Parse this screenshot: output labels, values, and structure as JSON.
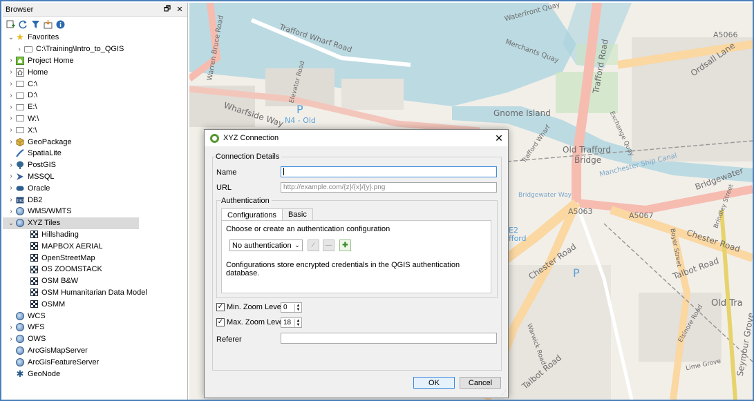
{
  "browser": {
    "title": "Browser",
    "title_buttons": [
      "🗗",
      "✕"
    ],
    "toolbar_icons": [
      "add-layer-icon",
      "refresh-icon",
      "filter-icon",
      "collapse-all-icon",
      "info-icon"
    ],
    "items": [
      {
        "label": "Favorites",
        "icon": "star-icon",
        "expanded": true
      },
      {
        "label": "C:\\Training\\Intro_to_QGIS",
        "icon": "folder-icon"
      },
      {
        "label": "Project Home",
        "icon": "project-home-icon"
      },
      {
        "label": "Home",
        "icon": "home-icon"
      },
      {
        "label": "C:\\",
        "icon": "drive-icon"
      },
      {
        "label": "D:\\",
        "icon": "drive-icon"
      },
      {
        "label": "E:\\",
        "icon": "drive-icon"
      },
      {
        "label": "W:\\",
        "icon": "drive-icon"
      },
      {
        "label": "X:\\",
        "icon": "drive-icon"
      },
      {
        "label": "GeoPackage",
        "icon": "geopackage-icon"
      },
      {
        "label": "SpatiaLite",
        "icon": "spatialite-icon"
      },
      {
        "label": "PostGIS",
        "icon": "postgis-icon"
      },
      {
        "label": "MSSQL",
        "icon": "mssql-icon"
      },
      {
        "label": "Oracle",
        "icon": "oracle-icon"
      },
      {
        "label": "DB2",
        "icon": "db2-icon"
      },
      {
        "label": "WMS/WMTS",
        "icon": "wms-icon"
      },
      {
        "label": "XYZ Tiles",
        "icon": "xyz-tiles-icon",
        "expanded": true
      },
      {
        "label": "Hillshading",
        "icon": "tile-icon"
      },
      {
        "label": "MAPBOX AERIAL",
        "icon": "tile-icon"
      },
      {
        "label": "OpenStreetMap",
        "icon": "tile-icon"
      },
      {
        "label": "OS ZOOMSTACK",
        "icon": "tile-icon"
      },
      {
        "label": "OSM B&W",
        "icon": "tile-icon"
      },
      {
        "label": "OSM Humanitarian Data Model",
        "icon": "tile-icon"
      },
      {
        "label": "OSMM",
        "icon": "tile-icon"
      },
      {
        "label": "WCS",
        "icon": "wcs-icon"
      },
      {
        "label": "WFS",
        "icon": "wfs-icon"
      },
      {
        "label": "OWS",
        "icon": "ows-icon"
      },
      {
        "label": "ArcGisMapServer",
        "icon": "arcgis-map-icon"
      },
      {
        "label": "ArcGisFeatureServer",
        "icon": "arcgis-feature-icon"
      },
      {
        "label": "GeoNode",
        "icon": "geonode-icon"
      }
    ]
  },
  "map": {
    "labels": [
      "Trafford Wharf Road",
      "Waterfront Quay",
      "Merchants Quay",
      "Warren Bruce Road",
      "Elevator Road",
      "Wharfside Way",
      "P",
      "N4 - Old",
      "Gnome Island",
      "Trafford Road",
      "Ordsall Lane",
      "A5066",
      "Exchange Quay",
      "Old Trafford",
      "Bridge",
      "Manchester Ship Canal",
      "Bridgewater Way",
      "Bridgewater",
      "A5063",
      "A5067",
      "Chester Road",
      "Chester Road",
      "Talbot Road",
      "Talbot Road",
      "Old Tra",
      "Seymour Grove",
      "E2",
      "fford",
      "Elsinore Road",
      "Lime Grove",
      "Warwick Road",
      "P",
      "Brindley Street",
      "Boyer Street",
      "Trafford Wharf"
    ]
  },
  "dialog": {
    "title": "XYZ Connection",
    "close": "✕",
    "connection_details": "Connection Details",
    "name_label": "Name",
    "name_value": "",
    "url_label": "URL",
    "url_placeholder": "http://example.com/{z}/{x}/{y}.png",
    "authentication": "Authentication",
    "tabs": [
      "Configurations",
      "Basic"
    ],
    "choose_text": "Choose or create an authentication configuration",
    "auth_select": "No authentication",
    "auth_note": "Configurations store encrypted credentials in the QGIS authentication database.",
    "min_zoom_label": "Min. Zoom Level",
    "min_zoom_value": "0",
    "max_zoom_label": "Max. Zoom Level",
    "max_zoom_value": "18",
    "referer_label": "Referer",
    "referer_value": "",
    "ok": "OK",
    "cancel": "Cancel"
  }
}
